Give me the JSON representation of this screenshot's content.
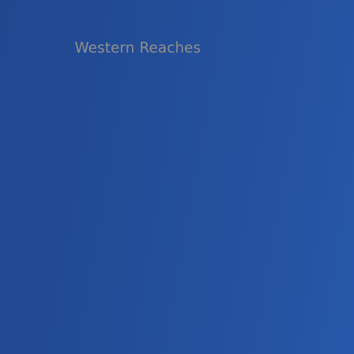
{
  "map": {
    "region_label": "Western Reaches",
    "label_color": "#8f8f8a",
    "water_color": "#234d98"
  }
}
